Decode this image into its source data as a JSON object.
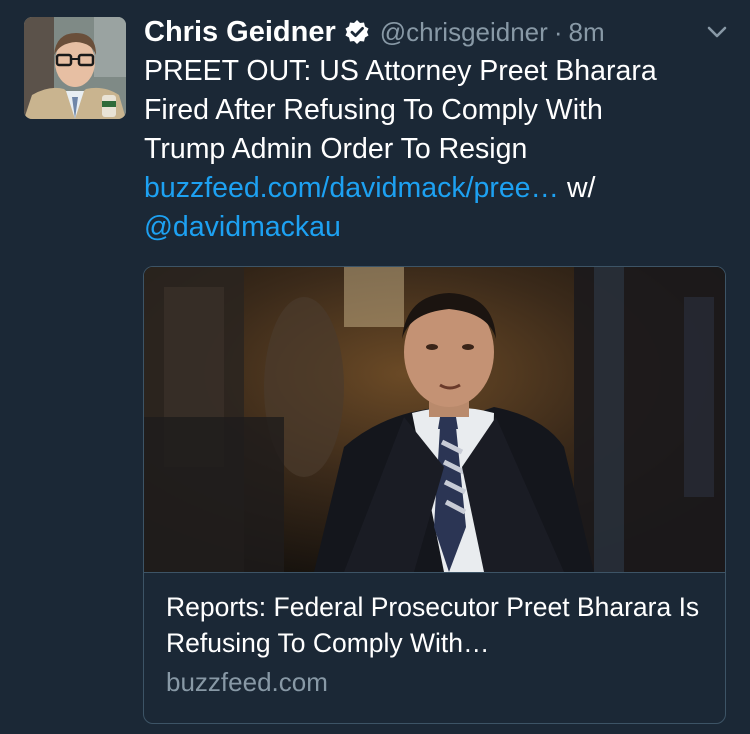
{
  "tweet": {
    "display_name": "Chris Geidner",
    "handle": "@chrisgeidner",
    "separator": "·",
    "time": "8m",
    "text_lines": [
      "PREET OUT: US Attorney Preet Bharara",
      "Fired After Refusing To Comply With",
      "Trump Admin Order To Resign"
    ],
    "link": "buzzfeed.com/davidmack/pree…",
    "with_label": " w/",
    "mention": "@davidmackau",
    "icons": {
      "verified": "verified-badge-icon",
      "more": "chevron-down-icon"
    }
  },
  "card": {
    "title": "Reports: Federal Prosecutor Preet Bharara Is Refusing To Comply With…",
    "domain": "buzzfeed.com"
  },
  "colors": {
    "background": "#1b2836",
    "link": "#1da1f2",
    "muted": "#8899a6",
    "border": "#3d5466"
  }
}
